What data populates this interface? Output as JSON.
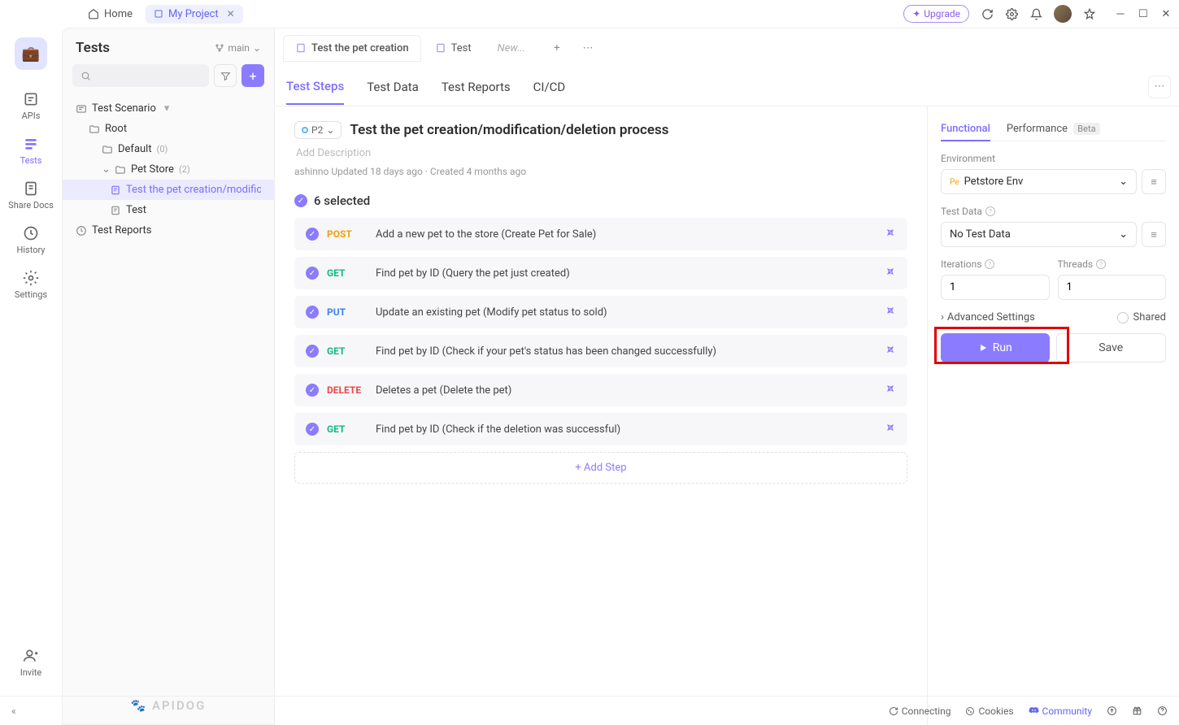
{
  "titlebar": {
    "home": "Home",
    "project": "My Project",
    "upgrade": "Upgrade"
  },
  "nav": {
    "apis": "APIs",
    "tests": "Tests",
    "share": "Share Docs",
    "history": "History",
    "settings": "Settings",
    "invite": "Invite"
  },
  "sidebar": {
    "title": "Tests",
    "branch": "main",
    "scenario": "Test Scenario",
    "root": "Root",
    "default": "Default",
    "default_count": "(0)",
    "petstore": "Pet Store",
    "petstore_count": "(2)",
    "test1": "Test the pet creation/modific",
    "test2": "Test",
    "reports": "Test Reports",
    "brand": "🐾 APIDOG"
  },
  "tabs": {
    "t1": "Test the pet creation",
    "t2": "Test",
    "t3": "New..."
  },
  "subtabs": {
    "t1": "Test Steps",
    "t2": "Test Data",
    "t3": "Test Reports",
    "t4": "CI/CD"
  },
  "scenario": {
    "priority": "P2",
    "title": "Test the pet creation/modification/deletion process",
    "desc_ph": "Add Description",
    "meta": "ashinno Updated 18 days ago · Created 4 months ago",
    "selected": "6 selected",
    "add_step": "Add Step"
  },
  "steps": [
    {
      "method": "POST",
      "name": "Add a new pet to the store (Create Pet for Sale)"
    },
    {
      "method": "GET",
      "name": "Find pet by ID (Query the pet just created)"
    },
    {
      "method": "PUT",
      "name": "Update an existing pet (Modify pet status to sold)"
    },
    {
      "method": "GET",
      "name": "Find pet by ID (Check if your pet's status has been changed successfully)"
    },
    {
      "method": "DELETE",
      "name": "Deletes a pet (Delete the pet)"
    },
    {
      "method": "GET",
      "name": "Find pet by ID (Check if the deletion was successful)"
    }
  ],
  "panel": {
    "tab_func": "Functional",
    "tab_perf": "Performance",
    "tab_perf_badge": "Beta",
    "env_label": "Environment",
    "env_value": "Petstore Env",
    "data_label": "Test Data",
    "data_value": "No Test Data",
    "iter_label": "Iterations",
    "iter_value": "1",
    "threads_label": "Threads",
    "threads_value": "1",
    "adv": "Advanced Settings",
    "shared": "Shared",
    "run": "Run",
    "save": "Save"
  },
  "status": {
    "connecting": "Connecting",
    "cookies": "Cookies",
    "community": "Community"
  }
}
